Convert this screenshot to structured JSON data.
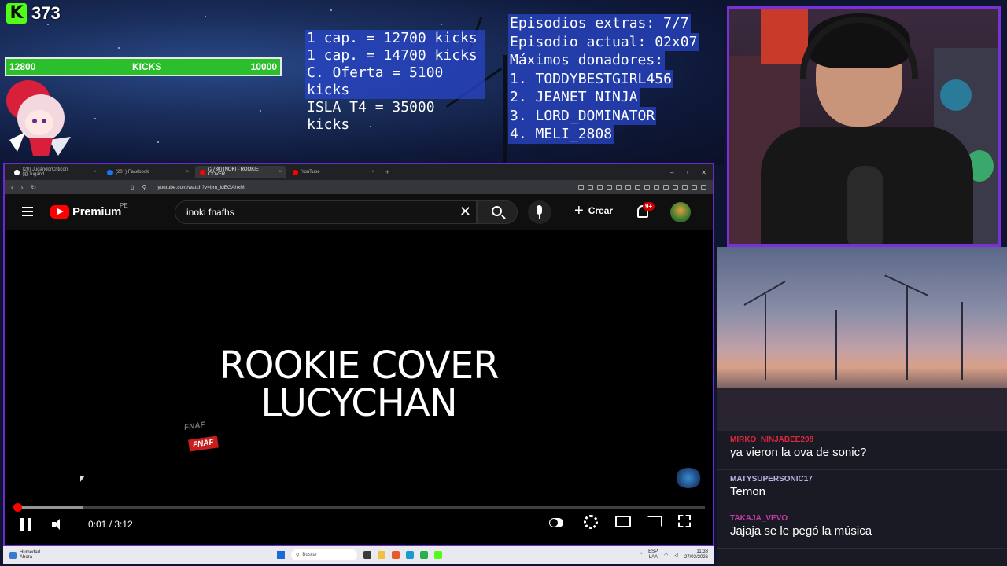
{
  "kick": {
    "count": "373"
  },
  "goal_bar": {
    "left": "12800",
    "label": "KICKS",
    "right": "10000",
    "fill_fraction": 1.0
  },
  "prices": [
    "1 cap. = 12700 kicks",
    "1 cap. = 14700 kicks",
    "C. Oferta = 5100 kicks",
    "ISLA T4 = 35000 kicks"
  ],
  "episodes": {
    "extras": "Episodios extras: 7/7",
    "current": "Episodio actual: 02x07",
    "donors_title": "Máximos donadores:",
    "donors": [
      "1. TODDYBESTGIRL456",
      "2. JEANET NINJA",
      "3. LORD_DOMINATOR",
      "4. MELI_2808"
    ]
  },
  "browser": {
    "tabs": [
      {
        "label": "(20) JugandorCriticon (@Jugand...",
        "color": "#ffffff"
      },
      {
        "label": "(20+) Facebook",
        "color": "#1877f2"
      },
      {
        "label": "(2730) INOKI - ROOKIE COVER",
        "color": "#ff0000",
        "active": true
      },
      {
        "label": "YouTube",
        "color": "#ff0000"
      }
    ],
    "url": "youtube.com/watch?v=bm_ldEGAhxM"
  },
  "youtube": {
    "brand": "Premium",
    "region": "PE",
    "search_value": "inoki fnafhs",
    "create_label": "Crear",
    "notif_badge": "9+"
  },
  "video": {
    "title_line1": "ROOKIE COVER",
    "title_line2": "LUCYCHAN",
    "stamp_a": "FNAF",
    "stamp_b": "FNAF",
    "time": "0:01 / 3:12",
    "played_fraction": 0.005,
    "loaded_fraction": 0.1
  },
  "taskbar": {
    "weather_title": "Humedad",
    "weather_sub": "Ahora",
    "search": "Buscar",
    "lang": "ESP",
    "lang_sub": "LAA",
    "clock": "11:38",
    "date": "27/03/2026"
  },
  "chat": [
    {
      "user": "MIRKO_NINJABEE208",
      "text": "ya vieron la ova de sonic?",
      "color": "#e0283c"
    },
    {
      "user": "MATYSUPERSONIC17",
      "text": "Temon",
      "color": "#b8b8e8"
    },
    {
      "user": "TAKAJA_VEVO",
      "text": "Jajaja se le pegó la música",
      "color": "#c83aa8"
    }
  ],
  "colors": {
    "accent_purple": "#7a30d8",
    "kick_green": "#53fc18",
    "yt_red": "#ff0000",
    "price_box_blue": "#2846c8"
  }
}
